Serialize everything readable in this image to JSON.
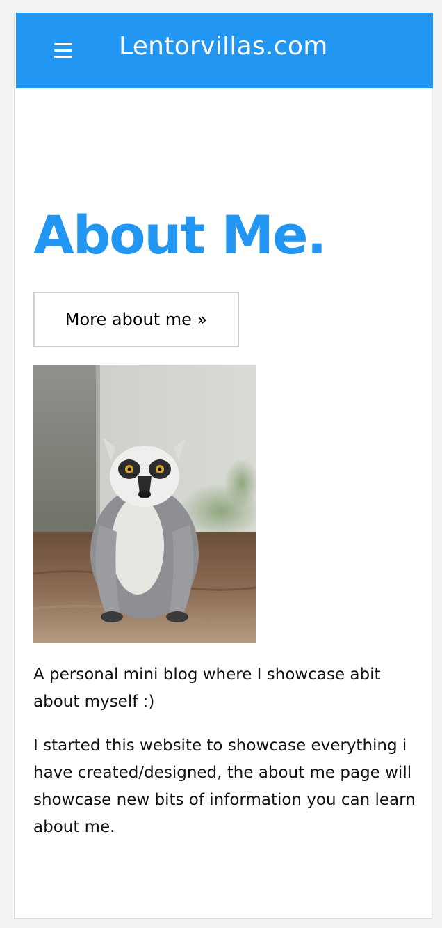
{
  "header": {
    "menu_icon": "hamburger-menu-icon",
    "site_title": "Lentorvillas.com",
    "background_color": "#2196f3"
  },
  "main": {
    "heading": "About Me.",
    "heading_color": "#2196f3",
    "more_button_label": "More about me »",
    "photo": "lemur-photo",
    "paragraph_1": "A personal mini blog where I showcase abit about myself :)",
    "paragraph_2": "I started this website to showcase everything i have created/designed, the about me page will showcase new bits of information you can learn about me."
  }
}
